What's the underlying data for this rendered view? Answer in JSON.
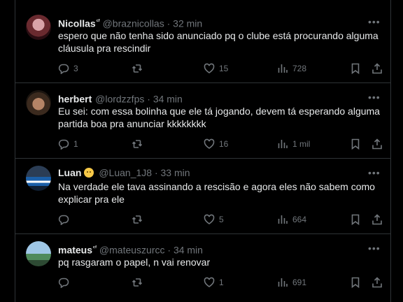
{
  "tweets": [
    {
      "name": "Nicollas",
      "badge": "ᶜᶠ",
      "handle": "@braznicollas",
      "time": "32 min",
      "text_lines": [
        "espero que não tenha sido anunciado pq o clube está procurando alguma",
        "cláusula pra rescindir"
      ],
      "replies": "3",
      "retweets": "",
      "likes": "15",
      "views": "728"
    },
    {
      "name": "herbert",
      "badge": "",
      "handle": "@lordzzfps",
      "time": "34 min",
      "text_lines": [
        "Eu sei: com essa bolinha que ele tá jogando, devem tá esperando alguma",
        "partida boa pra anunciar kkkkkkkk"
      ],
      "replies": "1",
      "retweets": "",
      "likes": "16",
      "views": "1 mil"
    },
    {
      "name": "Luan",
      "badge": "",
      "handle": "@Luan_1J8",
      "time": "33 min",
      "text_lines": [
        "Na verdade ele tava assinando a rescisão e agora eles não sabem como",
        "explicar pra ele"
      ],
      "replies": "",
      "retweets": "",
      "likes": "5",
      "views": "664"
    },
    {
      "name": "mateus",
      "badge": "ᶜᶠ",
      "handle": "@mateuszurcc",
      "time": "34 min",
      "text_lines": [
        "pq rasgaram o papel, n vai renovar"
      ],
      "replies": "",
      "retweets": "",
      "likes": "1",
      "views": "691"
    }
  ],
  "separator": "·",
  "icons": {
    "reply": "reply-icon",
    "retweet": "retweet-icon",
    "like": "heart-icon",
    "views": "views-icon",
    "bookmark": "bookmark-icon",
    "share": "share-icon",
    "more": "more-icon"
  },
  "colors": {
    "background": "#000000",
    "text": "#e7e9ea",
    "muted": "#71767b",
    "border": "#2f3336"
  }
}
